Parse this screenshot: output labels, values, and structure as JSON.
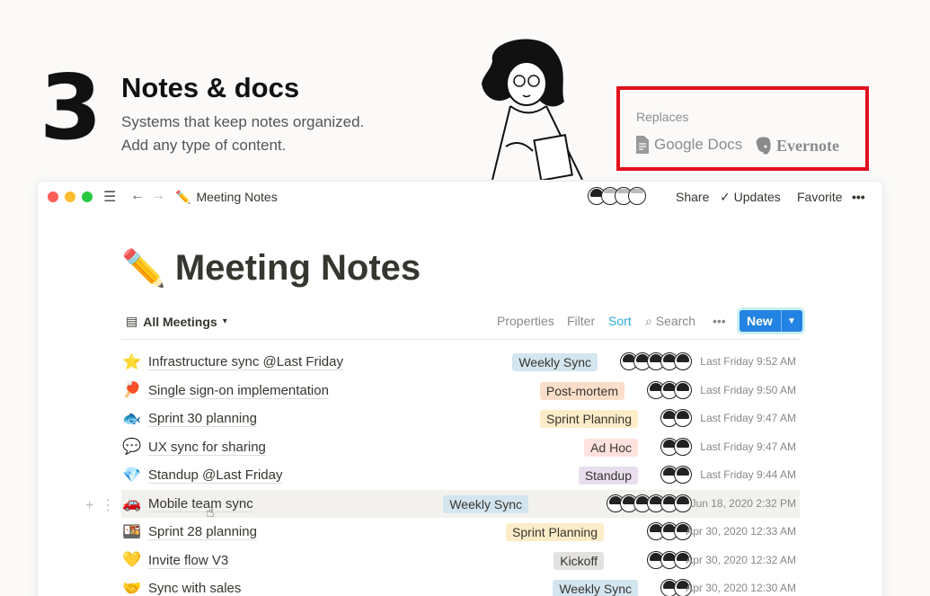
{
  "hero": {
    "number": "3",
    "title": "Notes & docs",
    "desc_line1": "Systems that keep notes organized.",
    "desc_line2": "Add any type of content."
  },
  "replaces": {
    "label": "Replaces",
    "products": [
      "Google Docs",
      "Evernote"
    ]
  },
  "window": {
    "breadcrumb_icon": "✏️",
    "breadcrumb": "Meeting Notes",
    "actions": {
      "share": "Share",
      "updates": "Updates",
      "favorite": "Favorite",
      "more": "•••"
    }
  },
  "page": {
    "icon": "✏️",
    "title": "Meeting Notes"
  },
  "view": {
    "name": "All Meetings",
    "properties": "Properties",
    "filter": "Filter",
    "sort": "Sort",
    "search": "Search",
    "more": "•••",
    "new": "New"
  },
  "rows": [
    {
      "emoji": "⭐",
      "name": "Infrastructure sync @Last Friday",
      "tag": "Weekly Sync",
      "tag_color": "#d3e5ef",
      "date": "Last Friday 9:52 AM"
    },
    {
      "emoji": "🏓",
      "name": "Single sign-on implementation",
      "tag": "Post-mortem",
      "tag_color": "#fadec9",
      "date": "Last Friday 9:50 AM"
    },
    {
      "emoji": "🐟",
      "name": "Sprint 30 planning",
      "tag": "Sprint Planning",
      "tag_color": "#fdecc8",
      "date": "Last Friday 9:47 AM"
    },
    {
      "emoji": "💬",
      "name": "UX sync for sharing",
      "tag": "Ad Hoc",
      "tag_color": "#ffe2dd",
      "date": "Last Friday 9:47 AM"
    },
    {
      "emoji": "💎",
      "name": "Standup @Last Friday",
      "tag": "Standup",
      "tag_color": "#e8deee",
      "date": "Last Friday 9:44 AM"
    },
    {
      "emoji": "🚗",
      "name": "Mobile team sync",
      "tag": "Weekly Sync",
      "tag_color": "#d3e5ef",
      "date": "Jun 18, 2020 2:32 PM"
    },
    {
      "emoji": "🍱",
      "name": "Sprint 28 planning",
      "tag": "Sprint Planning",
      "tag_color": "#fdecc8",
      "date": "Apr 30, 2020 12:33 AM"
    },
    {
      "emoji": "💛",
      "name": "Invite flow V3",
      "tag": "Kickoff",
      "tag_color": "#e3e2e0",
      "date": "Apr 30, 2020 12:32 AM"
    },
    {
      "emoji": "🤝",
      "name": "Sync with sales",
      "tag": "Weekly Sync",
      "tag_color": "#d3e5ef",
      "date": "Apr 30, 2020 12:30 AM"
    }
  ]
}
